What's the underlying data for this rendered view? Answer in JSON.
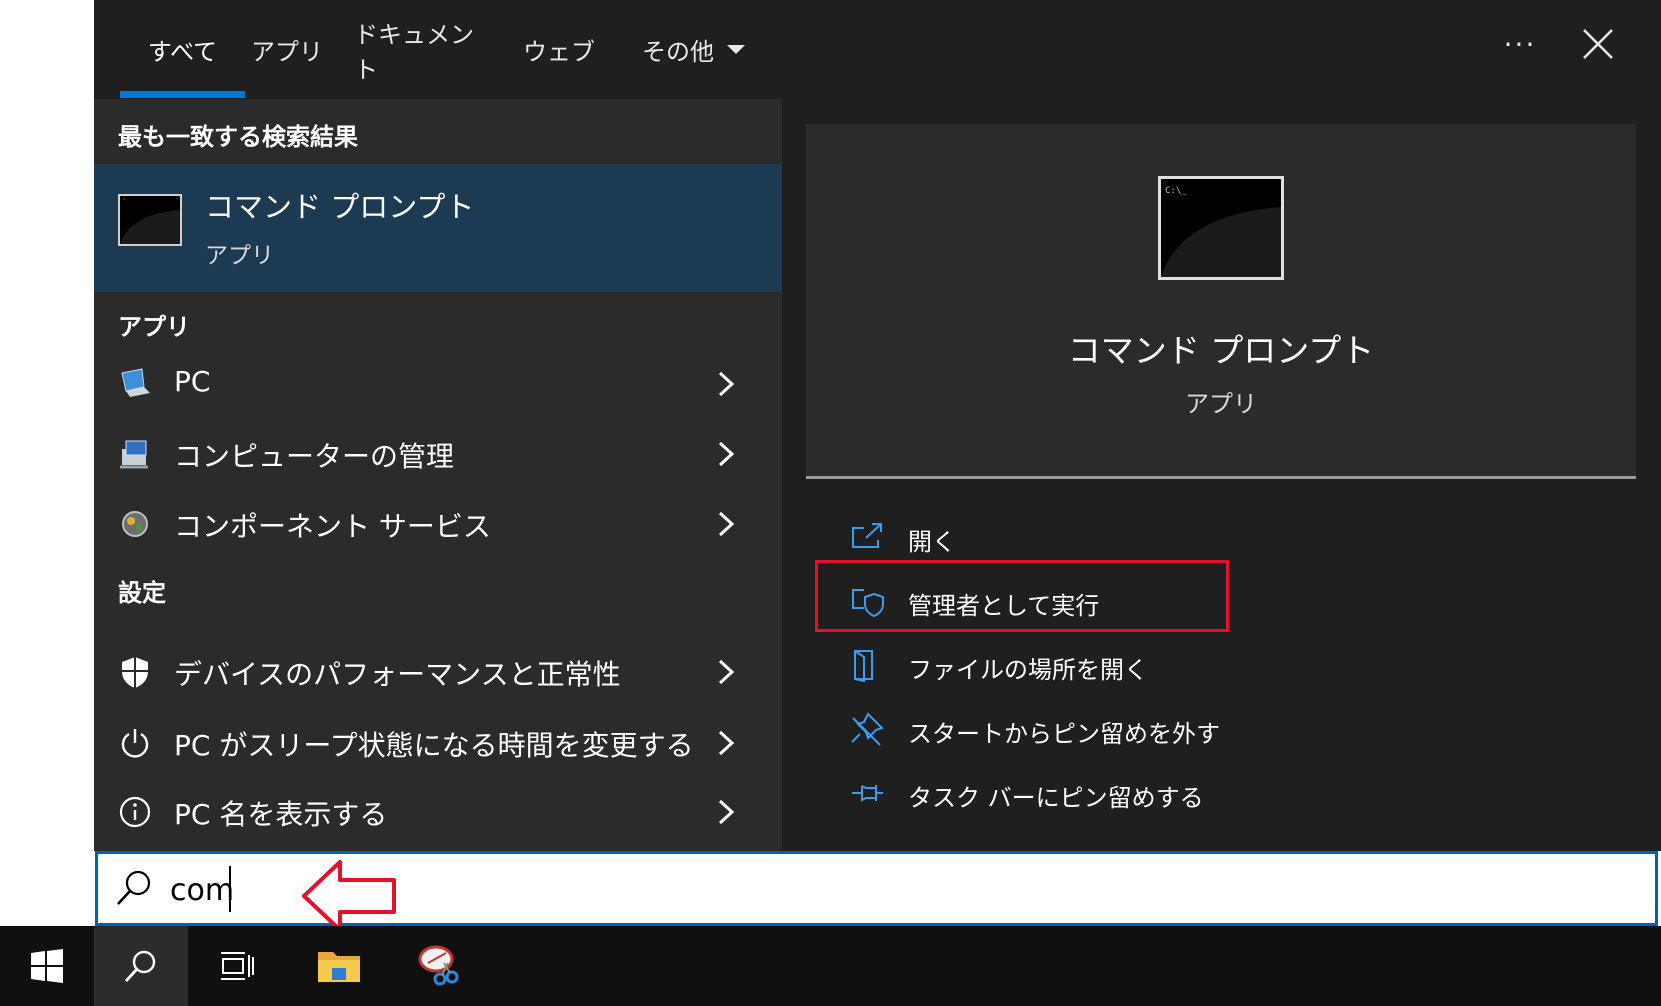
{
  "tabs": [
    {
      "label": "すべて",
      "active": true
    },
    {
      "label": "アプリ",
      "active": false
    },
    {
      "label": "ドキュメント",
      "active": false
    },
    {
      "label": "ウェブ",
      "active": false
    },
    {
      "label": "その他",
      "active": false,
      "dropdown": true
    }
  ],
  "more_label": "···",
  "best_match": {
    "header": "最も一致する検索結果",
    "title": "コマンド プロンプト",
    "subtitle": "アプリ",
    "icon": "command-prompt-icon"
  },
  "apps": {
    "header": "アプリ",
    "items": [
      {
        "label": "PC",
        "icon": "pc-icon"
      },
      {
        "label": "コンピューターの管理",
        "icon": "computer-management-icon"
      },
      {
        "label": "コンポーネント サービス",
        "icon": "component-services-icon"
      }
    ]
  },
  "settings": {
    "header": "設定",
    "items": [
      {
        "label": "デバイスのパフォーマンスと正常性",
        "icon": "shield-icon"
      },
      {
        "label": "PC がスリープ状態になる時間を変更する",
        "icon": "power-icon"
      },
      {
        "label": "PC 名を表示する",
        "icon": "info-icon"
      }
    ]
  },
  "detail": {
    "title": "コマンド プロンプト",
    "subtitle": "アプリ",
    "actions": [
      {
        "label": "開く",
        "icon": "open-icon"
      },
      {
        "label": "管理者として実行",
        "icon": "run-as-admin-icon",
        "highlighted": true
      },
      {
        "label": "ファイルの場所を開く",
        "icon": "file-location-icon"
      },
      {
        "label": "スタートからピン留めを外す",
        "icon": "unpin-start-icon"
      },
      {
        "label": "タスク バーにピン留めする",
        "icon": "pin-taskbar-icon"
      }
    ]
  },
  "search": {
    "value": "com",
    "placeholder": ""
  },
  "colors": {
    "accent": "#0078d4",
    "highlight_box": "#e5102a",
    "best_match_bg": "#1c3a52"
  }
}
